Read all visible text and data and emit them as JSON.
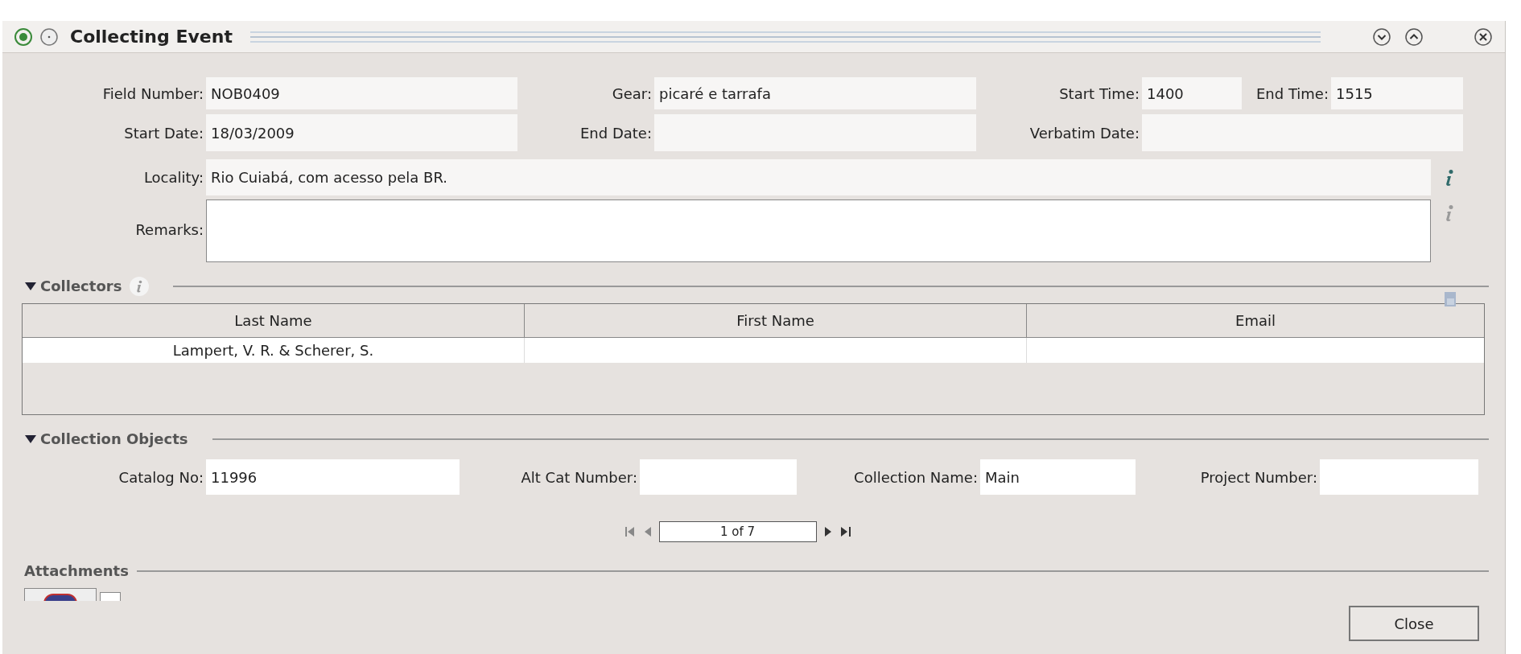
{
  "window": {
    "title": "Collecting Event"
  },
  "rows": [
    [
      {
        "label": "Field Number:",
        "value": "NOB0409"
      },
      {
        "label": "Gear:",
        "value": "picaré e tarrafa"
      },
      {
        "label": "Start Time:",
        "value": "1400"
      },
      {
        "label": "End Time:",
        "value": "1515"
      }
    ],
    [
      {
        "label": "Start Date:",
        "value": "18/03/2009"
      },
      {
        "label": "End Date:"
      },
      {
        "label": "Verbatim Date:"
      }
    ]
  ],
  "locality": {
    "label": "Locality:",
    "value": "Rio Cuiabá, com acesso pela BR."
  },
  "remarks": {
    "label": "Remarks:"
  },
  "collectors": {
    "title": "Collectors",
    "expanded": true,
    "columns": [
      "Last Name",
      "First Name",
      "Email"
    ],
    "rows": [
      {
        "last_name": "Lampert, V. R. & Scherer, S."
      }
    ]
  },
  "collection_objects": {
    "title": "Collection Objects",
    "expanded": true,
    "fields": [
      {
        "label": "Catalog No:",
        "value": "11996"
      },
      {
        "label": "Alt Cat Number:"
      },
      {
        "label": "Collection Name:",
        "value": "Main"
      },
      {
        "label": "Project Number:"
      }
    ],
    "pager": {
      "text": "1 of 7"
    }
  },
  "attachments": {
    "title": "Attachments"
  },
  "buttons": [
    "Close"
  ]
}
